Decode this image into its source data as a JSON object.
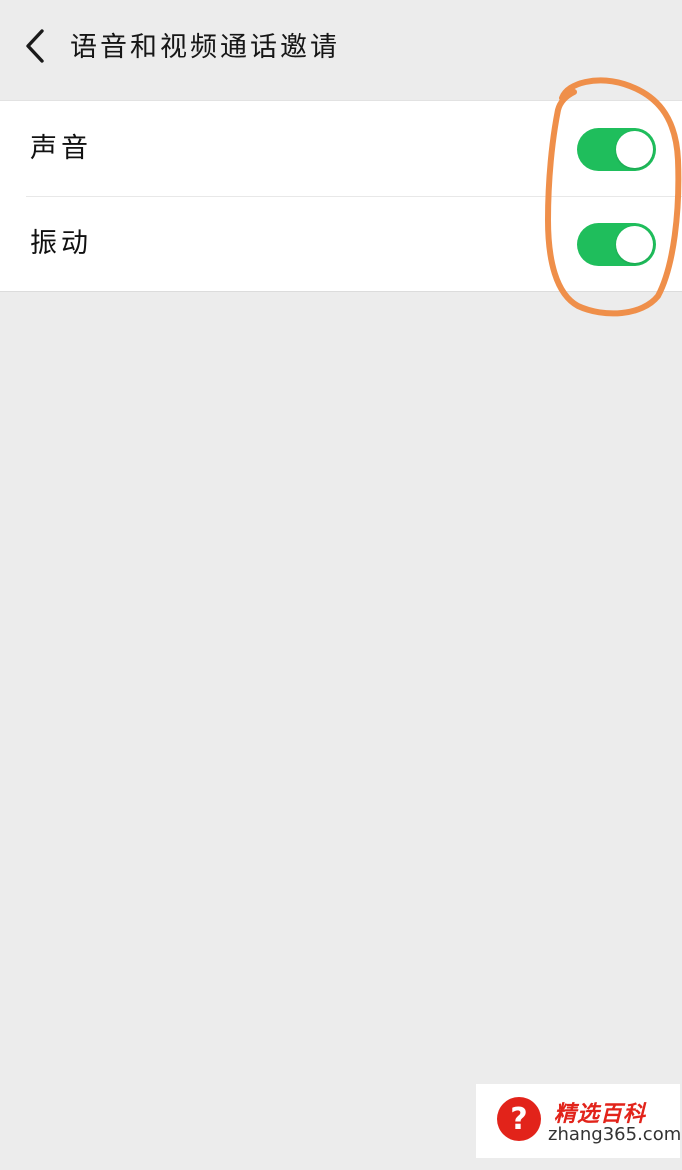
{
  "header": {
    "title": "语音和视频通话邀请",
    "back_icon": "chevron-left-icon"
  },
  "settings": {
    "items": [
      {
        "label": "声音",
        "enabled": true
      },
      {
        "label": "振动",
        "enabled": true
      }
    ]
  },
  "watermark": {
    "title": "精选百科",
    "url": "zhang365.com"
  },
  "colors": {
    "background": "#ececec",
    "toggle_on": "#1fbe5c",
    "annotation_circle": "#ef8f4a",
    "watermark_red": "#e2231a"
  }
}
